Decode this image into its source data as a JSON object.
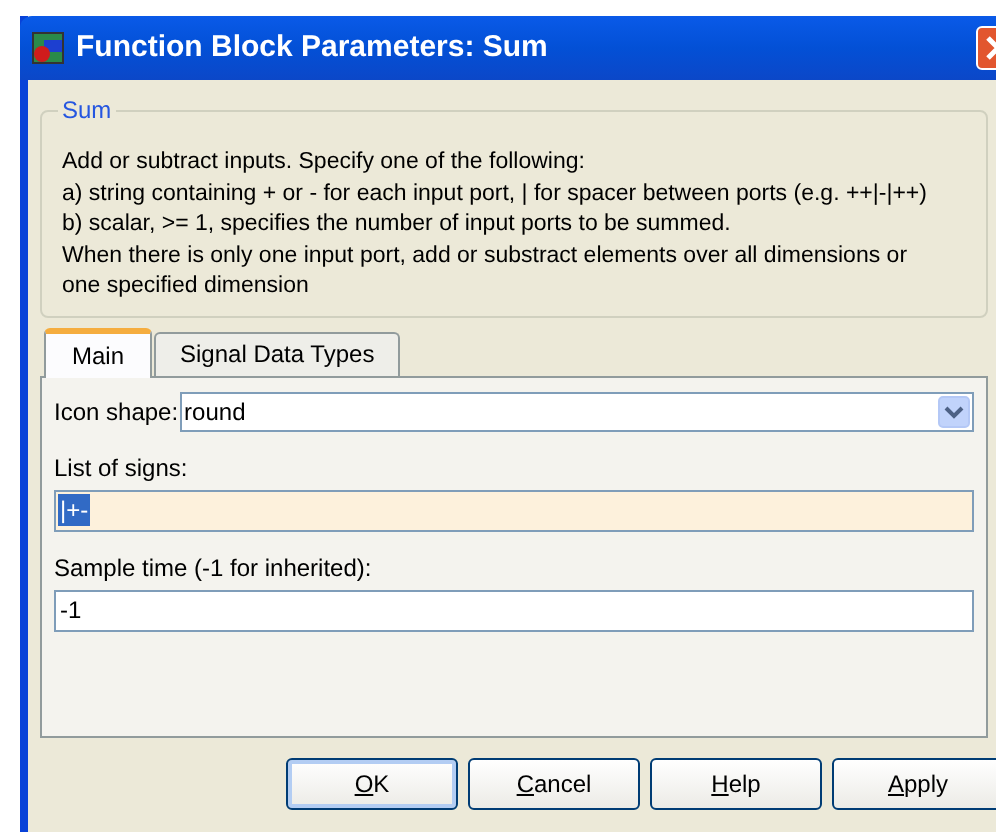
{
  "window": {
    "title": "Function Block Parameters: Sum"
  },
  "group": {
    "title": "Sum",
    "description": [
      "Add or subtract inputs.  Specify one of the following:",
      "a) string containing + or - for each input port, | for spacer between ports (e.g. ++|-|++)",
      "b) scalar, >= 1, specifies the number of input ports to be summed.",
      "When there is only one input port, add or substract elements over all dimensions or",
      "one specified dimension"
    ]
  },
  "tabs": [
    {
      "label": "Main",
      "selected": true
    },
    {
      "label": "Signal Data Types",
      "selected": false
    }
  ],
  "fields": [
    {
      "kind": "dropdown",
      "label": "Icon shape:",
      "value": "round",
      "focused": false,
      "text_selected": false
    },
    {
      "kind": "text",
      "label": "List of signs:",
      "value": "|+-",
      "focused": true,
      "text_selected": true
    },
    {
      "kind": "text",
      "label": "Sample time (-1 for inherited):",
      "value": "-1",
      "focused": false,
      "text_selected": false
    }
  ],
  "buttons": [
    {
      "label": "OK",
      "default": true,
      "mnemonic_underlined": true
    },
    {
      "label": "Cancel",
      "default": false,
      "mnemonic_underlined": true
    },
    {
      "label": "Help",
      "default": false,
      "mnemonic_underlined": true
    },
    {
      "label": "Apply",
      "default": false,
      "mnemonic_underlined": true
    }
  ]
}
